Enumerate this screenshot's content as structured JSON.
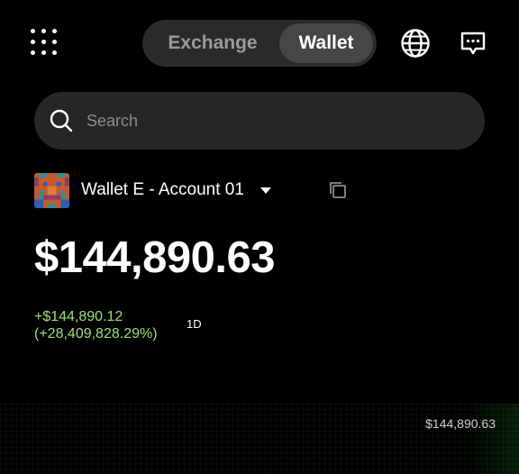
{
  "header": {
    "tabs": [
      {
        "label": "Exchange",
        "active": false
      },
      {
        "label": "Wallet",
        "active": true
      }
    ],
    "icons": {
      "menu": "grid-menu-icon",
      "language": "globe-icon",
      "messages": "chat-icon"
    }
  },
  "search": {
    "placeholder": "Search",
    "value": ""
  },
  "account": {
    "name": "Wallet E - Account 01",
    "avatar": "pixel-art-avatar"
  },
  "portfolio": {
    "balance": "$144,890.63",
    "change_amount": "+$144,890.12",
    "change_percent": "(+28,409,828.29%)",
    "period": "1D",
    "chart_value_label": "$144,890.63"
  },
  "colors": {
    "accent_positive": "#9be07a",
    "background": "#000000",
    "surface": "#262626"
  }
}
